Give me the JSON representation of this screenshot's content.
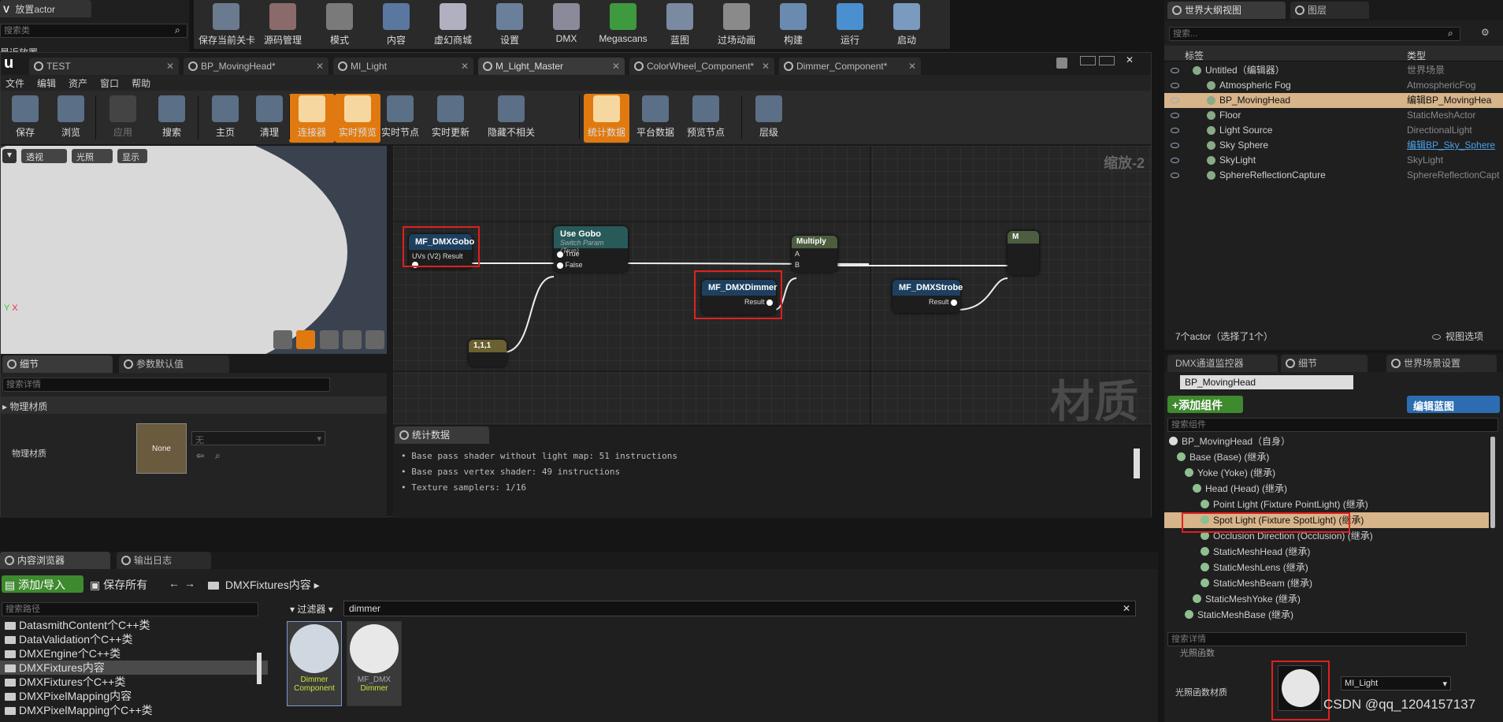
{
  "place_actor": {
    "title": "放置actor",
    "search_placeholder": "搜索类",
    "recent": "最近放置"
  },
  "main_toolbar": {
    "items": [
      {
        "id": "save-current",
        "label": "保存当前关卡"
      },
      {
        "id": "source-control",
        "label": "源码管理"
      },
      {
        "id": "modes",
        "label": "模式"
      },
      {
        "id": "content",
        "label": "内容"
      },
      {
        "id": "marketplace",
        "label": "虚幻商城"
      },
      {
        "id": "settings",
        "label": "设置"
      },
      {
        "id": "dmx",
        "label": "DMX"
      },
      {
        "id": "megascans",
        "label": "Megascans"
      },
      {
        "id": "blueprints",
        "label": "蓝图"
      },
      {
        "id": "cinematics",
        "label": "过场动画"
      },
      {
        "id": "build",
        "label": "构建"
      },
      {
        "id": "play",
        "label": "运行"
      },
      {
        "id": "launch",
        "label": "启动"
      }
    ]
  },
  "editor_tabs": [
    {
      "label": "TEST",
      "active": false
    },
    {
      "label": "BP_MovingHead*",
      "active": false
    },
    {
      "label": "MI_Light",
      "active": false
    },
    {
      "label": "M_Light_Master",
      "active": true
    },
    {
      "label": "ColorWheel_Component*",
      "active": false
    },
    {
      "label": "Dimmer_Component*",
      "active": false
    }
  ],
  "menu": [
    "文件",
    "编辑",
    "资产",
    "窗口",
    "帮助"
  ],
  "material_toolbar": [
    {
      "label": "保存",
      "state": "normal"
    },
    {
      "label": "浏览",
      "state": "normal"
    },
    {
      "label": "应用",
      "state": "disabled"
    },
    {
      "label": "搜索",
      "state": "normal"
    },
    {
      "label": "主页",
      "state": "normal"
    },
    {
      "label": "清理",
      "state": "normal"
    },
    {
      "label": "连接器",
      "state": "active"
    },
    {
      "label": "实时预览",
      "state": "active"
    },
    {
      "label": "实时节点",
      "state": "normal"
    },
    {
      "label": "实时更新",
      "state": "normal"
    },
    {
      "label": "隐藏不相关",
      "state": "normal"
    },
    {
      "label": "统计数据",
      "state": "active"
    },
    {
      "label": "平台数据",
      "state": "normal"
    },
    {
      "label": "预览节点",
      "state": "normal"
    },
    {
      "label": "层级",
      "state": "normal"
    }
  ],
  "viewport": {
    "btn_perspective": "透视",
    "btn_lit": "光照",
    "btn_show": "显示",
    "axis_y": "Y",
    "axis_x": "X"
  },
  "details_tabs": {
    "details": "细节",
    "param_defaults": "参数默认值",
    "search_placeholder": "搜索详情",
    "section": "物理材质",
    "row_label": "物理材质",
    "thumb_label": "None",
    "dropdown_value": "无"
  },
  "graph": {
    "zoom": "缩放-2",
    "watermark": "材质",
    "nodes": {
      "gobo": {
        "title": "MF_DMXGobo",
        "pin_in": "UVs (V2)",
        "pin_out": "Result"
      },
      "usegobo": {
        "title": "Use Gobo",
        "subtitle": "Switch Param (True)",
        "pin_true": "True",
        "pin_false": "False"
      },
      "const": {
        "title": "1,1,1"
      },
      "dimmer": {
        "title": "MF_DMXDimmer",
        "pin_out": "Result"
      },
      "multiply": {
        "title": "Multiply",
        "pin_a": "A",
        "pin_b": "B"
      },
      "strobe": {
        "title": "MF_DMXStrobe",
        "pin_out": "Result"
      },
      "partial": {
        "title": "M"
      }
    }
  },
  "stats": {
    "tab": "统计数据",
    "lines": [
      "Base pass shader without light map: 51 instructions",
      "Base pass vertex shader: 49 instructions",
      "Texture samplers: 1/16"
    ]
  },
  "outliner": {
    "tabs": [
      "世界大纲视图",
      "图层"
    ],
    "search_placeholder": "搜索...",
    "col_label": "标签",
    "col_type": "类型",
    "rows": [
      {
        "label": "Untitled（编辑器）",
        "type": "世界场景",
        "indent": 1,
        "selected": false
      },
      {
        "label": "Atmospheric Fog",
        "type": "AtmosphericFog",
        "indent": 2,
        "selected": false
      },
      {
        "label": "BP_MovingHead",
        "type": "编辑BP_MovingHea",
        "indent": 2,
        "selected": true
      },
      {
        "label": "Floor",
        "type": "StaticMeshActor",
        "indent": 2,
        "selected": false
      },
      {
        "label": "Light Source",
        "type": "DirectionalLight",
        "indent": 2,
        "selected": false
      },
      {
        "label": "Sky Sphere",
        "type": "编辑BP_Sky_Sphere",
        "indent": 2,
        "selected": false
      },
      {
        "label": "SkyLight",
        "type": "SkyLight",
        "indent": 2,
        "selected": false
      },
      {
        "label": "SphereReflectionCapture",
        "type": "SphereReflectionCapt",
        "indent": 2,
        "selected": false
      }
    ],
    "count": "7个actor（选择了1个）",
    "view_options": "视图选项"
  },
  "details_panel": {
    "tabs": [
      "DMX通道监控器",
      "细节",
      "世界场景设置"
    ],
    "name_value": "BP_MovingHead",
    "add_component": "+添加组件",
    "edit_blueprint": "编辑蓝图",
    "search_components": "搜索组件",
    "components": [
      {
        "label": "BP_MovingHead（自身）",
        "indent": 0,
        "selected": false
      },
      {
        "label": "Base (Base) (继承)",
        "indent": 1,
        "selected": false
      },
      {
        "label": "Yoke (Yoke) (继承)",
        "indent": 2,
        "selected": false
      },
      {
        "label": "Head (Head) (继承)",
        "indent": 3,
        "selected": false
      },
      {
        "label": "Point Light (Fixture PointLight) (继承)",
        "indent": 4,
        "selected": false
      },
      {
        "label": "Spot Light (Fixture SpotLight) (继承)",
        "indent": 4,
        "selected": true
      },
      {
        "label": "Occlusion Direction (Occlusion) (继承)",
        "indent": 4,
        "selected": false
      },
      {
        "label": "StaticMeshHead (继承)",
        "indent": 4,
        "selected": false
      },
      {
        "label": "StaticMeshLens (继承)",
        "indent": 4,
        "selected": false
      },
      {
        "label": "StaticMeshBeam (继承)",
        "indent": 4,
        "selected": false
      },
      {
        "label": "StaticMeshYoke (继承)",
        "indent": 3,
        "selected": false
      },
      {
        "label": "StaticMeshBase (继承)",
        "indent": 2,
        "selected": false
      }
    ],
    "search_details": "搜索详情",
    "light_func_section": "光照函数",
    "light_func_label": "光照函数材质",
    "light_func_value": "MI_Light"
  },
  "content_browser": {
    "tabs": [
      "内容浏览器",
      "输出日志"
    ],
    "add_import": "添加/导入",
    "save_all": "保存所有",
    "path": "DMXFixtures内容",
    "search_paths": "搜索路径",
    "filter": "过滤器",
    "filter_text": "dimmer",
    "folders": [
      "DatasmithContent个C++类",
      "DataValidation个C++类",
      "DMXEngine个C++类",
      "DMXFixtures内容",
      "DMXFixtures个C++类",
      "DMXPixelMapping内容",
      "DMXPixelMapping个C++类"
    ],
    "selected_folder": "DMXFixtures内容",
    "assets": [
      {
        "name": "Dimmer",
        "sub": "Component"
      },
      {
        "name": "MF_DMX",
        "sub": "Dimmer"
      }
    ]
  },
  "watermark": "CSDN @qq_1204157137"
}
